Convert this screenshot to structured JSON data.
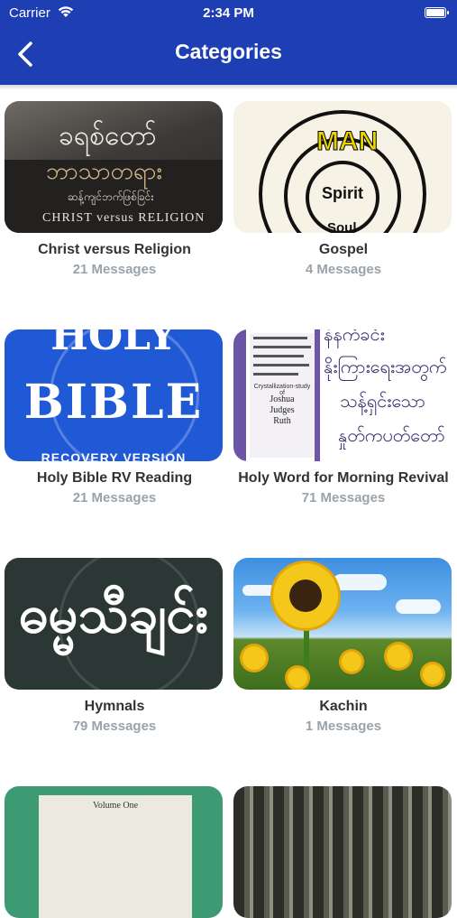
{
  "status_bar": {
    "carrier": "Carrier",
    "time": "2:34 PM"
  },
  "nav": {
    "title": "Categories",
    "back_icon": "chevron-left-icon"
  },
  "colors": {
    "nav_bg": "#1e3eb4",
    "title_text": "#333333",
    "count_text": "#9aa2aa"
  },
  "thumbnail_text": {
    "christ": {
      "mm_line1": "ခရစ်တော်",
      "mm_line2": "ဘာသာတရား",
      "mm_line3": "ဆန့်ကျင်ဘက်ဖြစ်ခြင်း",
      "en": "CHRIST versus RELIGION"
    },
    "gospel": {
      "man": "MAN",
      "spirit": "Spirit",
      "soul": "Soul"
    },
    "bible": {
      "holy": "HOLY",
      "bible": "BIBLE",
      "recovery": "RECOVERY VERSION"
    },
    "word": {
      "study": "Crystallization-study of",
      "books": [
        "Joshua",
        "Judges",
        "Ruth"
      ],
      "mm_lines": [
        "နံနက်ခင်း",
        "နိုးကြားရေးအတွက်",
        "သန့်ရှင်းသော",
        "နှုတ်ကပတ်တော်"
      ]
    },
    "hymn": {
      "mm": "ဓမ္မသီချင်း"
    },
    "green": {
      "volume": "Volume One"
    }
  },
  "categories": [
    {
      "name": "Christ versus Religion",
      "count": "21 Messages"
    },
    {
      "name": "Gospel",
      "count": "4 Messages"
    },
    {
      "name": "Holy Bible RV Reading",
      "count": "21 Messages"
    },
    {
      "name": "Holy Word for Morning Revival",
      "count": "71 Messages"
    },
    {
      "name": "Hymnals",
      "count": "79 Messages"
    },
    {
      "name": "Kachin",
      "count": "1 Messages"
    }
  ]
}
